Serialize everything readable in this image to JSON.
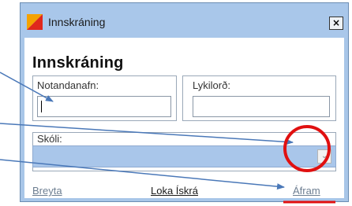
{
  "window": {
    "title": "Innskráning",
    "close_glyph": "×"
  },
  "form": {
    "heading": "Innskráning",
    "username_label": "Notandanafn:",
    "username_value": "",
    "password_label": "Lykilorð:",
    "password_value": "",
    "school_label": "Skóli:",
    "school_value": "",
    "dropdown_glyph": "⌄"
  },
  "footer": {
    "change_label": "Breyta",
    "close_label": "Loka Ískrá",
    "next_label": "Áfram"
  },
  "colors": {
    "titlebar": "#a9c7ea",
    "select_fill": "#a9c6ea",
    "link_gray": "#6d7e91",
    "link_dark": "#1a1a1a",
    "annotation_arrow": "#4a78b8",
    "annotation_red": "#e01010"
  },
  "icons": {
    "app_logo": "app-logo-icon",
    "close": "close-icon",
    "dropdown": "chevron-down-icon"
  }
}
